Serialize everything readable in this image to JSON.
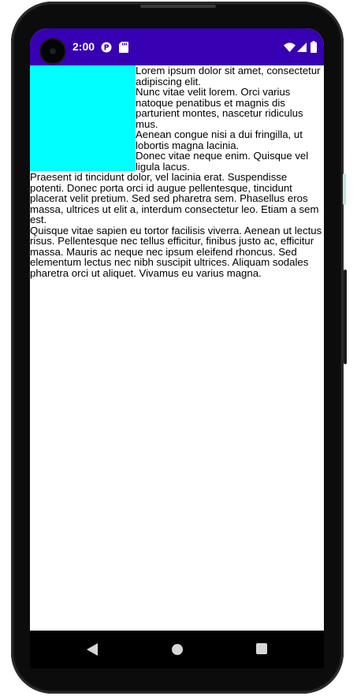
{
  "status_bar": {
    "time": "2:00",
    "background": "#3700b3",
    "icons": [
      "notification-app-icon",
      "sd-card-icon",
      "wifi-icon",
      "cellular-signal-icon",
      "battery-icon"
    ]
  },
  "content": {
    "box_color": "#00ffff",
    "paragraphs": [
      "Lorem ipsum dolor sit amet, consectetur adipiscing elit.",
      "Nunc vitae velit lorem. Orci varius natoque penatibus et magnis dis parturient montes, nascetur ridiculus mus.",
      "Aenean congue nisi a dui fringilla, ut lobortis magna lacinia.",
      "Donec vitae neque enim. Quisque vel ligula lacus.",
      "Praesent id tincidunt dolor, vel lacinia erat. Suspendisse potenti. Donec porta orci id augue pellentesque, tincidunt placerat velit pretium. Sed sed pharetra sem. Phasellus eros massa, ultrices ut elit a, interdum consectetur leo. Etiam a sem est.",
      "Quisque vitae sapien eu tortor facilisis viverra. Aenean ut lectus risus. Pellentesque nec tellus efficitur, finibus justo ac, efficitur massa. Mauris ac neque nec ipsum eleifend rhoncus. Sed elementum lectus nec nibh suscipit ultrices. Aliquam sodales pharetra orci ut aliquet. Vivamus eu varius magna."
    ]
  },
  "nav_bar": {
    "buttons": [
      "back-icon",
      "home-icon",
      "recents-icon"
    ]
  }
}
